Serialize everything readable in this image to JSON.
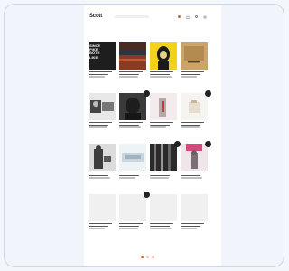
{
  "site": {
    "logo_text": "Scott",
    "logo_suffix": "",
    "search_placeholder": ""
  },
  "header_icons": [
    "cart-icon",
    "bag-icon",
    "user-icon",
    "menu-icon"
  ],
  "products": [
    {
      "label": "",
      "cover_text": "SINCE\nPIKE\nBOTH\nLIKE",
      "badge": "",
      "cover": "cover-text-black"
    },
    {
      "label": "",
      "cover_text": "",
      "badge": "",
      "cover": "cover-desert"
    },
    {
      "label": "",
      "cover_text": "",
      "badge": "",
      "cover": "cover-yellow-portrait"
    },
    {
      "label": "",
      "cover_text": "",
      "badge": "",
      "cover": "cover-tan"
    },
    {
      "label": "",
      "cover_text": "",
      "badge": "",
      "cover": "cover-bw-collage"
    },
    {
      "label": "",
      "cover_text": "",
      "badge": "",
      "cover": "cover-dark-portrait"
    },
    {
      "label": "",
      "cover_text": "",
      "badge": "",
      "cover": "cover-pink-figure"
    },
    {
      "label": "",
      "cover_text": "",
      "badge": "",
      "cover": "cover-pale-still"
    },
    {
      "label": "",
      "cover_text": "",
      "badge": "",
      "cover": "cover-gray-figure"
    },
    {
      "label": "",
      "cover_text": "",
      "badge": "",
      "cover": "cover-light-blue"
    },
    {
      "label": "",
      "cover_text": "",
      "badge": "",
      "cover": "cover-dark-stripes"
    },
    {
      "label": "",
      "cover_text": "",
      "badge": "",
      "cover": "cover-pink-statue"
    },
    {
      "label": "",
      "cover_text": "",
      "badge": "",
      "cover": "placeholder"
    },
    {
      "label": "",
      "cover_text": "",
      "badge": "",
      "cover": "placeholder"
    },
    {
      "label": "",
      "cover_text": "",
      "badge": "",
      "cover": "placeholder"
    },
    {
      "label": "",
      "cover_text": "",
      "badge": "",
      "cover": "placeholder"
    }
  ],
  "pagination": {
    "pages": 3,
    "active": 1
  },
  "colors": {
    "accent": "#e65a2d",
    "dark_badge": "#222222"
  }
}
